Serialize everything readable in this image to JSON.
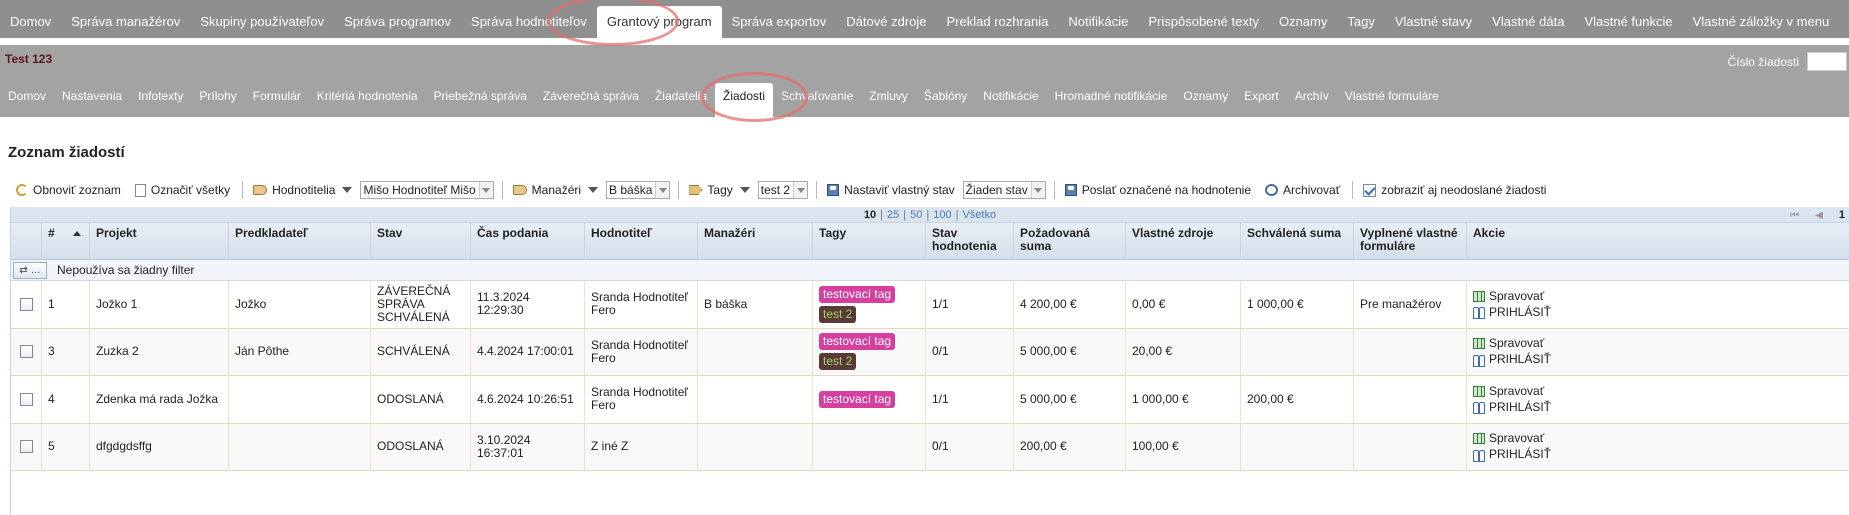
{
  "top_nav": {
    "items": [
      "Domov",
      "Správa manažérov",
      "Skupiny používateľov",
      "Správa programov",
      "Správa hodnotiteľov",
      "Grantový program",
      "Správa exportov",
      "Dátové zdroje",
      "Preklad rozhrania",
      "Notifikácie",
      "Prispôsobené texty",
      "Oznamy",
      "Tagy",
      "Vlastné stavy",
      "Vlastné dáta",
      "Vlastné funkcie",
      "Vlastné záložky v menu"
    ],
    "active": "Grantový program"
  },
  "program": {
    "title": "Test 123",
    "app_number_label": "Číslo žiadosti",
    "app_number_value": ""
  },
  "sub_nav": {
    "items": [
      "Domov",
      "Nastavenia",
      "Infotexty",
      "Prílohy",
      "Formulár",
      "Kritériá hodnotenia",
      "Priebežná správa",
      "Záverečná správa",
      "Žiadatelia",
      "Žiadosti",
      "Schvaľovanie",
      "Zmluvy",
      "Šablóny",
      "Notifikácie",
      "Hromadné notifikácie",
      "Oznamy",
      "Export",
      "Archív",
      "Vlastné formuláre"
    ],
    "active": "Žiadosti"
  },
  "page": {
    "title": "Zoznam žiadostí"
  },
  "toolbar": {
    "refresh": "Obnoviť zoznam",
    "select_all": "Označiť všetky",
    "evaluators": "Hodnotitelia",
    "evaluator_value": "Mišo Hodnotiteľ Mišo",
    "managers": "Manažéri",
    "manager_value": "B báška",
    "tags": "Tagy",
    "tag_value": "test 2",
    "set_status": "Nastaviť vlastný stav",
    "status_value": "Žiaden stav",
    "send_eval": "Poslať označené na hodnotenie",
    "archive": "Archivovať",
    "show_unsent": "zobraziť aj neodoslané žiadosti"
  },
  "pager": {
    "sizes": [
      "10",
      "25",
      "50",
      "100",
      "Všetko"
    ],
    "current_size": "10",
    "page": "1",
    "first": "⏮",
    "prev": "◀"
  },
  "columns": [
    "#",
    "Projekt",
    "Predkladateľ",
    "Stav",
    "Čas podania",
    "Hodnotiteľ",
    "Manažéri",
    "Tagy",
    "Stav hodnotenia",
    "Požadovaná suma",
    "Vlastné zdroje",
    "Schválená suma",
    "Vyplnené vlastné formuláre",
    "Akcie"
  ],
  "filter": {
    "button": "⇄ …",
    "text": "Nepoužíva sa žiadny filter"
  },
  "rows": [
    {
      "num": "1",
      "project": "Jožko 1",
      "submitter": "Jožko",
      "status_lines": [
        "ZÁVEREČNÁ",
        "SPRÁVA",
        "SCHVÁLENÁ"
      ],
      "time": "11.3.2024 12:29:30",
      "evaluator": "Sranda Hodnotiteľ Fero",
      "managers": "B báška",
      "tags": [
        "testovací tag",
        "test 2"
      ],
      "eval_status": "1/1",
      "requested": "4 200,00 €",
      "own": "0,00 €",
      "approved": "1 000,00 €",
      "forms": "Pre manažérov"
    },
    {
      "num": "3",
      "project": "Zuzka 2",
      "submitter": "Ján Pôthe",
      "status_lines": [
        "SCHVÁLENÁ"
      ],
      "time": "4.4.2024 17:00:01",
      "evaluator": "Sranda Hodnotiteľ Fero",
      "managers": "",
      "tags": [
        "testovací tag",
        "test 2"
      ],
      "eval_status": "0/1",
      "requested": "5 000,00 €",
      "own": "20,00 €",
      "approved": "",
      "forms": ""
    },
    {
      "num": "4",
      "project": "Zdenka má rada Jožka",
      "submitter": "",
      "status_lines": [
        "ODOSLANÁ"
      ],
      "time": "4.6.2024 10:26:51",
      "evaluator": "Sranda Hodnotiteľ Fero",
      "managers": "",
      "tags": [
        "testovací tag"
      ],
      "eval_status": "1/1",
      "requested": "5 000,00 €",
      "own": "1 000,00 €",
      "approved": "200,00 €",
      "forms": ""
    },
    {
      "num": "5",
      "project": "dfgdgdsffg",
      "submitter": "",
      "status_lines": [
        "ODOSLANÁ"
      ],
      "time": "3.10.2024 16:37:01",
      "evaluator": "Z iné Z",
      "managers": "",
      "tags": [],
      "eval_status": "0/1",
      "requested": "200,00 €",
      "own": "100,00 €",
      "approved": "",
      "forms": ""
    }
  ],
  "actions": {
    "manage": "Spravovať",
    "login": "PRIHLÁSIŤ"
  },
  "colors": {
    "nav_bg": "#8f8f8f",
    "subnav_bg": "#a3a3a3",
    "tag_pink": "#d63fa0",
    "tag_dark": "#5a3a36",
    "highlight": "#e46c6c"
  }
}
